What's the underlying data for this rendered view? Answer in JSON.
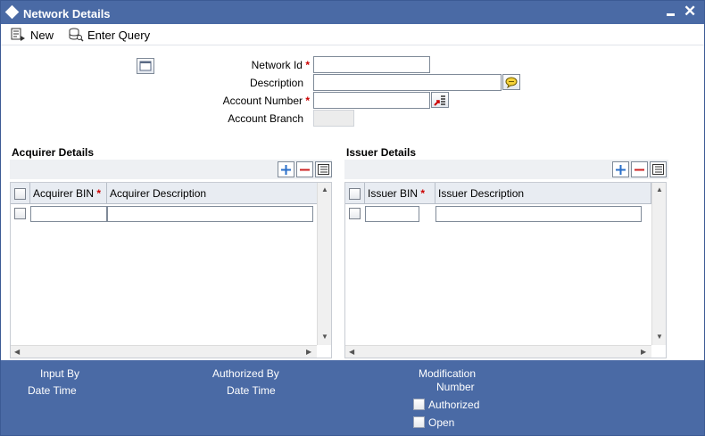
{
  "window": {
    "title": "Network Details",
    "minimize_icon": "minimize-icon",
    "close_icon": "close-icon",
    "close_glyph": "✕"
  },
  "toolbar": {
    "new_label": "New",
    "enter_query_label": "Enter Query"
  },
  "form": {
    "network_id_label": "Network Id",
    "description_label": "Description",
    "account_number_label": "Account Number",
    "account_branch_label": "Account Branch",
    "required_mark": "*",
    "network_id_value": "",
    "description_value": "",
    "account_number_value": "",
    "account_branch_value": ""
  },
  "acquirer": {
    "section_title": "Acquirer Details",
    "columns": [
      "Acquirer BIN",
      "Acquirer Description"
    ],
    "required_mark": "*"
  },
  "issuer": {
    "section_title": "Issuer Details",
    "columns": [
      "Issuer BIN",
      "Issuer Description"
    ],
    "required_mark": "*"
  },
  "footer": {
    "input_by": "Input By",
    "date_time_1": "Date Time",
    "authorized_by": "Authorized By",
    "date_time_2": "Date Time",
    "modification": "Modification",
    "number": "Number",
    "authorized": "Authorized",
    "open": "Open"
  },
  "colors": {
    "titlebar": "#4a6aa5",
    "required": "#cc0000",
    "grid_add": "#2a6fc9",
    "grid_delete": "#cc2222"
  }
}
